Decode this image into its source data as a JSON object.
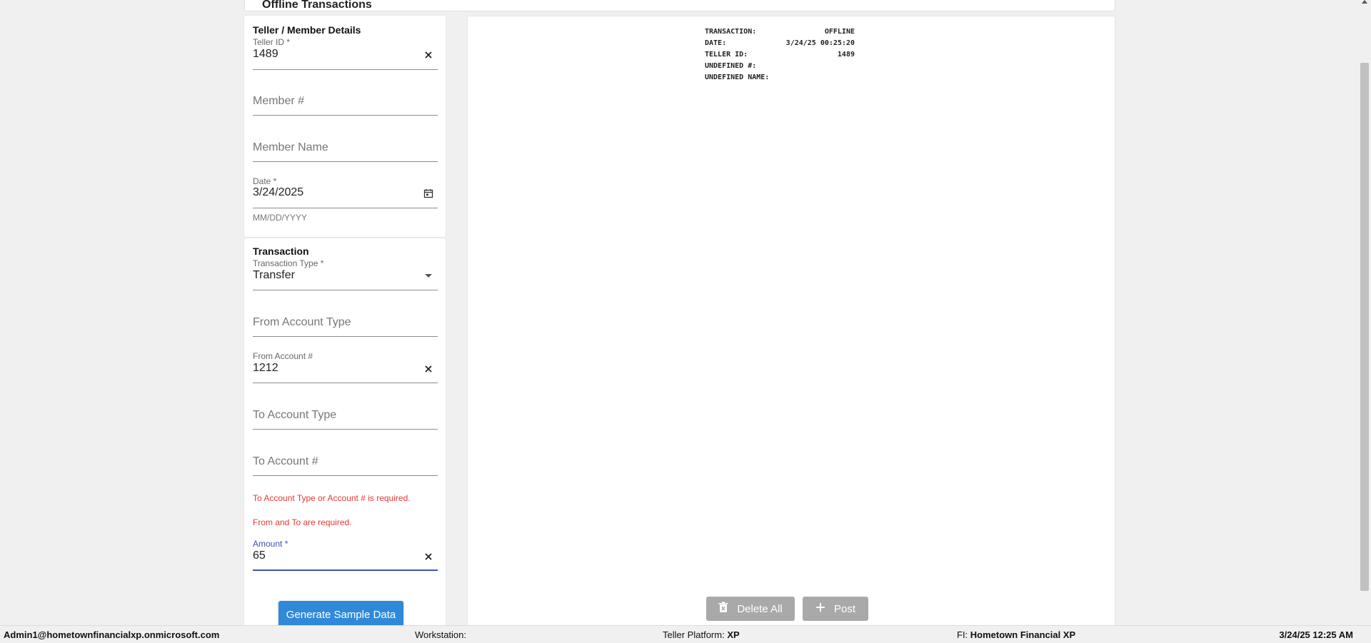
{
  "page": {
    "title": "Offline Transactions"
  },
  "member_section": {
    "title": "Teller / Member Details",
    "teller_id": {
      "label": "Teller ID *",
      "value": "1489"
    },
    "member_number": {
      "placeholder": "Member #"
    },
    "member_name": {
      "placeholder": "Member Name"
    },
    "date": {
      "label": "Date *",
      "value": "3/24/2025",
      "hint": "MM/DD/YYYY"
    }
  },
  "transaction_section": {
    "title": "Transaction",
    "transaction_type": {
      "label": "Transaction Type *",
      "value": "Transfer"
    },
    "from_account_type": {
      "placeholder": "From Account Type"
    },
    "from_account_number": {
      "label": "From Account #",
      "value": "1212"
    },
    "to_account_type": {
      "placeholder": "To Account Type"
    },
    "to_account_number": {
      "placeholder": "To Account #"
    },
    "errors": [
      "To Account Type or Account # is required.",
      "From and To are required."
    ],
    "amount": {
      "label": "Amount *",
      "value": "65"
    },
    "generate_button": "Generate Sample Data"
  },
  "receipt": {
    "rows": [
      {
        "label": "TRANSACTION:",
        "value": "OFFLINE"
      },
      {
        "label": "DATE:",
        "value": "3/24/25 00:25:20"
      },
      {
        "label": "TELLER ID:",
        "value": "1489"
      },
      {
        "label": "UNDEFINED #:",
        "value": ""
      },
      {
        "label": "UNDEFINED NAME:",
        "value": ""
      }
    ]
  },
  "actions": {
    "delete_all": "Delete All",
    "post": "Post"
  },
  "status_bar": {
    "user": "Admin1@hometownfinancialxp.onmicrosoft.com",
    "workstation_label": "Workstation:",
    "workstation_value": "",
    "platform_label": "Teller Platform:",
    "platform_value": "XP",
    "fi_label": "FI:",
    "fi_value": "Hometown Financial XP",
    "datetime": "3/24/25 12:25 AM"
  },
  "colors": {
    "accent": "#3f51b5",
    "error": "#e53935",
    "primary_button": "#2f89d8",
    "disabled_button": "#a9a9a9"
  },
  "icons": [
    "close-icon",
    "calendar-icon",
    "dropdown-arrow-icon",
    "trash-icon",
    "plus-icon"
  ]
}
